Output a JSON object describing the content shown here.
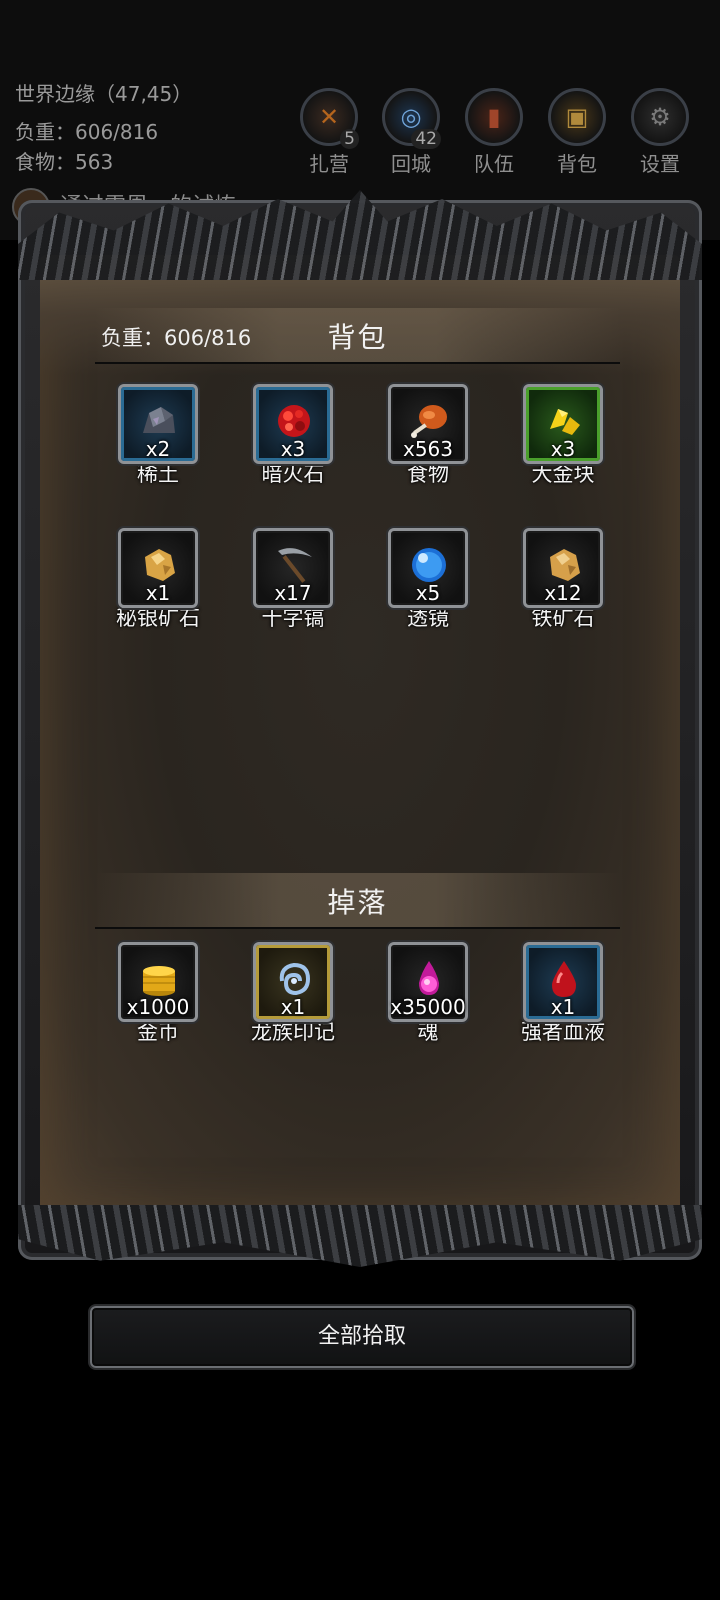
{
  "hud": {
    "location": "世界边缘（47,45）",
    "weight": "负重：606/816",
    "food": "食物：563",
    "quest": "通过雷恩…的试炼",
    "buttons": [
      {
        "label": "扎营",
        "badge": "5",
        "icon": "camp-icon"
      },
      {
        "label": "回城",
        "badge": "42",
        "icon": "portal-icon"
      },
      {
        "label": "队伍",
        "badge": "",
        "icon": "team-icon"
      },
      {
        "label": "背包",
        "badge": "",
        "icon": "backpack-icon"
      },
      {
        "label": "设置",
        "badge": "",
        "icon": "gear-icon"
      }
    ]
  },
  "backpack": {
    "title": "背包",
    "weight": "负重：606/816",
    "items": [
      {
        "name": "稀土",
        "count": "x2",
        "rarity": "blue",
        "icon": "rare-earth-icon"
      },
      {
        "name": "暗火石",
        "count": "x3",
        "rarity": "blue",
        "icon": "dark-fire-stone-icon"
      },
      {
        "name": "食物",
        "count": "x563",
        "rarity": "gray",
        "icon": "meat-icon"
      },
      {
        "name": "大金块",
        "count": "x3",
        "rarity": "green",
        "icon": "gold-nugget-icon"
      },
      {
        "name": "秘银矿石",
        "count": "x1",
        "rarity": "gray",
        "icon": "mithril-ore-icon"
      },
      {
        "name": "十字镐",
        "count": "x17",
        "rarity": "gray",
        "icon": "pickaxe-icon"
      },
      {
        "name": "透镜",
        "count": "x5",
        "rarity": "gray",
        "icon": "lens-icon"
      },
      {
        "name": "铁矿石",
        "count": "x12",
        "rarity": "gray",
        "icon": "iron-ore-icon"
      }
    ]
  },
  "drops": {
    "title": "掉落",
    "items": [
      {
        "name": "金币",
        "count": "x1000",
        "rarity": "gray",
        "icon": "gold-coins-icon"
      },
      {
        "name": "龙族印记",
        "count": "x1",
        "rarity": "gold",
        "icon": "dragon-mark-icon"
      },
      {
        "name": "魂",
        "count": "x35000",
        "rarity": "gray",
        "icon": "soul-icon"
      },
      {
        "name": "强者血液",
        "count": "x1",
        "rarity": "blue",
        "icon": "blood-drop-icon"
      }
    ]
  },
  "pick_all_label": "全部拾取"
}
